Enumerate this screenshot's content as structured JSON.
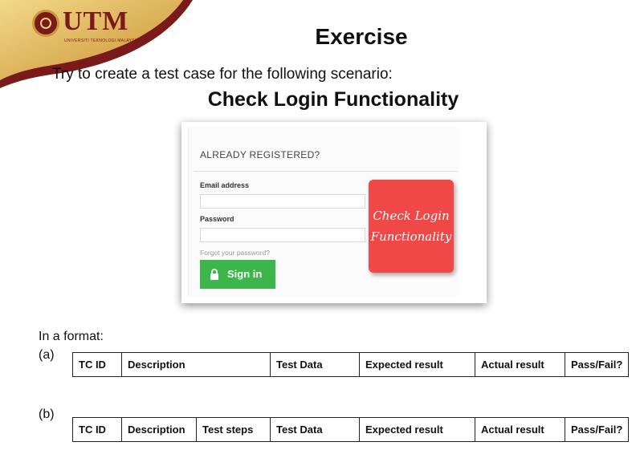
{
  "logo": {
    "text": "UTM",
    "subtext": "UNIVERSITI TEKNOLOGI MALAYSIA"
  },
  "title": "Exercise",
  "intro": "Try to create a test case for the following scenario:",
  "subtitle": "Check Login Functionality",
  "login_screenshot": {
    "heading": "ALREADY REGISTERED?",
    "email_label": "Email address",
    "email_value": "",
    "password_label": "Password",
    "password_value": "",
    "forgot_link": "Forgot your password?",
    "signin_button": "Sign in",
    "sticky_note": {
      "line1": "Check Login",
      "line2": "Functionality"
    }
  },
  "format_label": "In a format:",
  "table_a": {
    "label": "(a)",
    "headers": [
      "TC ID",
      "Description",
      "Test Data",
      "Expected result",
      "Actual result",
      "Pass/Fail?"
    ]
  },
  "table_b": {
    "label": "(b)",
    "headers": [
      "TC ID",
      "Description",
      "Test steps",
      "Test Data",
      "Expected result",
      "Actual result",
      "Pass/Fail?"
    ]
  },
  "colors": {
    "gold": "#d9a93a",
    "maroon": "#7a1a1a",
    "signin_green": "#3cb54a",
    "sticky_red": "#f04747"
  }
}
